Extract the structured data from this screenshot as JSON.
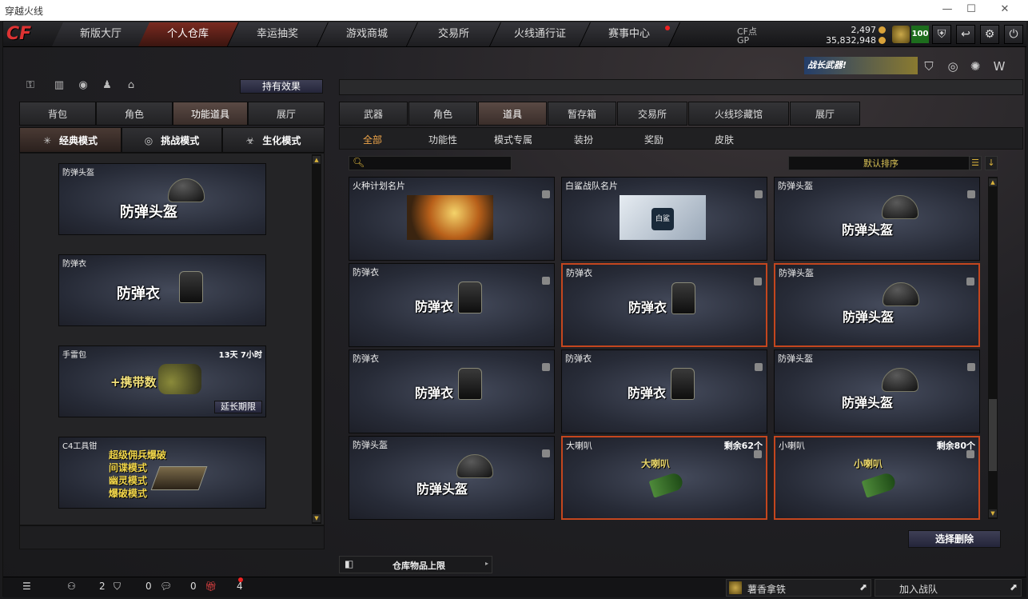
{
  "window": {
    "title": "穿越火线",
    "min": "—",
    "max": "☐",
    "close": "✕"
  },
  "nav": {
    "logo": "CF",
    "tabs": [
      {
        "label": "新版大厅"
      },
      {
        "label": "个人仓库"
      },
      {
        "label": "幸运抽奖"
      },
      {
        "label": "游戏商城"
      },
      {
        "label": "交易所"
      },
      {
        "label": "火线通行证"
      },
      {
        "label": "赛事中心"
      }
    ]
  },
  "currency": {
    "cf_label": "CF点",
    "cf_value": "2,497",
    "gp_label": "GP",
    "gp_value": "35,832,948"
  },
  "level": "100",
  "banner": "战长武器!",
  "left": {
    "effect_button": "持有效果",
    "tabs": [
      {
        "label": "背包"
      },
      {
        "label": "角色"
      },
      {
        "label": "功能道具"
      },
      {
        "label": "展厅"
      }
    ],
    "modes": [
      {
        "label": "经典模式",
        "icon": "✳"
      },
      {
        "label": "挑战模式",
        "icon": "◎"
      },
      {
        "label": "生化模式",
        "icon": "☣"
      }
    ],
    "items": [
      {
        "name": "防弹头盔",
        "big": "防弹头盔"
      },
      {
        "name": "防弹衣",
        "big": "防弹衣"
      },
      {
        "name": "手雷包",
        "big": "+携带数",
        "timer": "13天 7小时",
        "extend": "延长期限"
      },
      {
        "name": "C4工具钳",
        "lines": [
          "超级佣兵爆破",
          "间谍模式",
          "幽灵模式",
          "爆破模式"
        ]
      }
    ]
  },
  "right": {
    "tabs": [
      {
        "label": "武器"
      },
      {
        "label": "角色"
      },
      {
        "label": "道具"
      },
      {
        "label": "暂存箱"
      },
      {
        "label": "交易所"
      },
      {
        "label": "火线珍藏馆"
      },
      {
        "label": "展厅"
      }
    ],
    "subtabs": [
      {
        "label": "全部"
      },
      {
        "label": "功能性"
      },
      {
        "label": "模式专属"
      },
      {
        "label": "装扮"
      },
      {
        "label": "奖励"
      },
      {
        "label": "皮肤"
      }
    ],
    "sort": "默认排序",
    "items": [
      {
        "name": "火种计划名片",
        "kind": "card1"
      },
      {
        "name": "白鲨战队名片",
        "kind": "card2",
        "card_text": "白鲨"
      },
      {
        "name": "防弹头盔",
        "kind": "helm",
        "big": "防弹头盔"
      },
      {
        "name": "防弹衣",
        "kind": "vest",
        "big": "防弹衣"
      },
      {
        "name": "防弹衣",
        "kind": "vest",
        "big": "防弹衣",
        "sel": true
      },
      {
        "name": "防弹头盔",
        "kind": "helm",
        "big": "防弹头盔",
        "sel": true
      },
      {
        "name": "防弹衣",
        "kind": "vest",
        "big": "防弹衣"
      },
      {
        "name": "防弹衣",
        "kind": "vest",
        "big": "防弹衣"
      },
      {
        "name": "防弹头盔",
        "kind": "helm",
        "big": "防弹头盔"
      },
      {
        "name": "防弹头盔",
        "kind": "helm",
        "big": "防弹头盔"
      },
      {
        "name": "大喇叭",
        "kind": "horn",
        "small": "大喇叭",
        "remain": "剩余62个",
        "sel": true
      },
      {
        "name": "小喇叭",
        "kind": "horn",
        "small": "小喇叭",
        "remain": "剩余80个",
        "sel": true
      }
    ],
    "delete_button": "选择删除",
    "warehouse_limit": "仓库物品上限"
  },
  "bottom": {
    "friends": "2",
    "shield": "0",
    "msg": "0",
    "gift": "4",
    "clan": "薯香拿铁",
    "join": "加入战队"
  }
}
